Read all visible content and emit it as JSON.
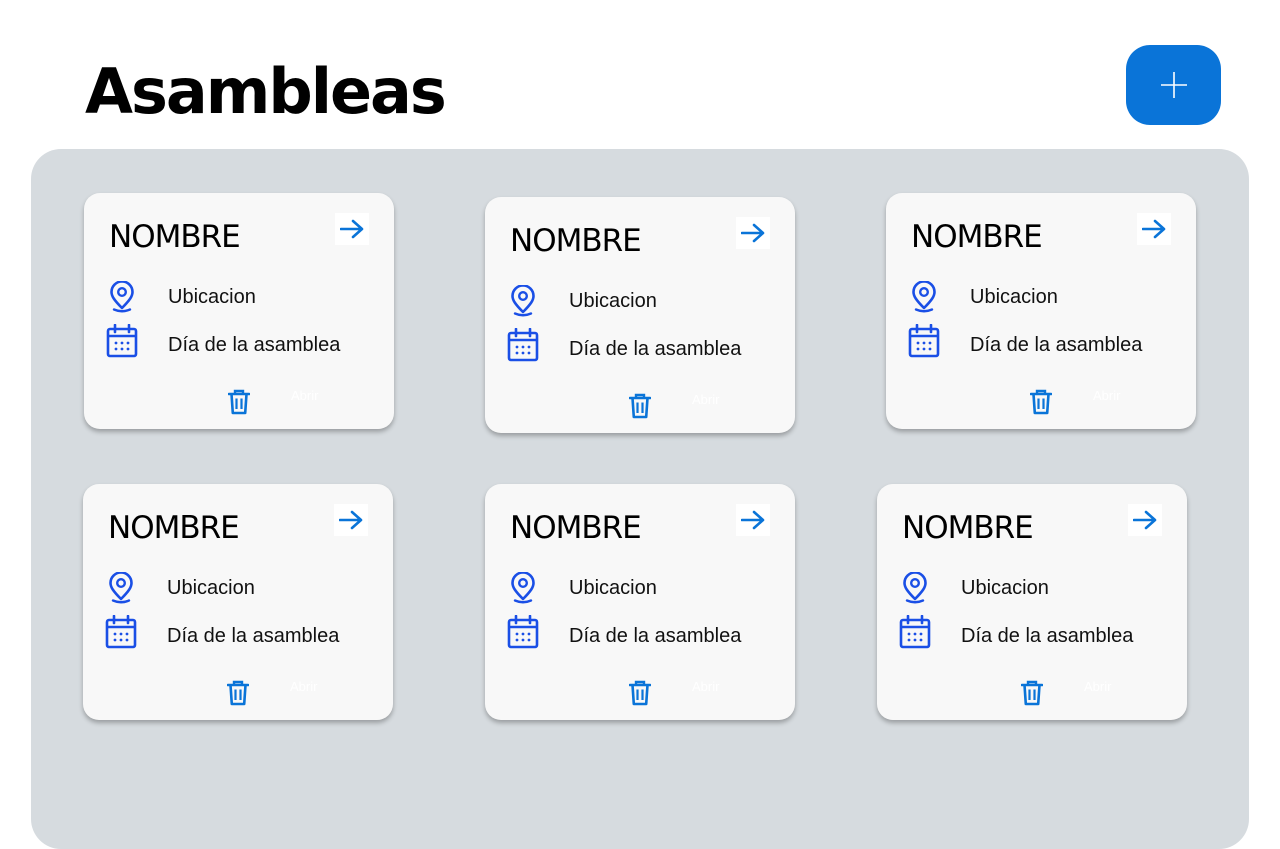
{
  "header": {
    "title": "Asambleas",
    "add_icon": "plus-icon"
  },
  "colors": {
    "accent": "#0a74d8",
    "icon_blue": "#1a4fe6",
    "panel": "#d6dbdf",
    "card": "#f8f8f8"
  },
  "cards": [
    {
      "name": "NOMBRE",
      "location": "Ubicacion",
      "date": "Día de la asamblea",
      "open_label": "Abrir"
    },
    {
      "name": "NOMBRE",
      "location": "Ubicacion",
      "date": "Día de la asamblea",
      "open_label": "Abrir"
    },
    {
      "name": "NOMBRE",
      "location": "Ubicacion",
      "date": "Día de la asamblea",
      "open_label": "Abrir"
    },
    {
      "name": "NOMBRE",
      "location": "Ubicacion",
      "date": "Día de la asamblea",
      "open_label": "Abrir"
    },
    {
      "name": "NOMBRE",
      "location": "Ubicacion",
      "date": "Día de la asamblea",
      "open_label": "Abrir"
    },
    {
      "name": "NOMBRE",
      "location": "Ubicacion",
      "date": "Día de la asamblea",
      "open_label": "Abrir"
    }
  ],
  "icons": {
    "location": "map-pin-icon",
    "date": "calendar-icon",
    "delete": "trash-icon",
    "open": "arrow-right-icon"
  }
}
